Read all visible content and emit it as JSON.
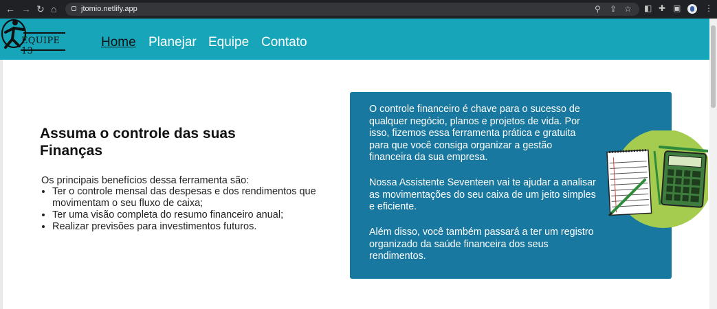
{
  "browser": {
    "url": "jtomio.netlify.app",
    "back_icon": "arrow-left",
    "forward_icon": "arrow-right",
    "reload_icon": "reload",
    "home_icon": "home"
  },
  "header": {
    "logo_text": "EQUIPE 13",
    "nav": [
      "Home",
      "Planejar",
      "Equipe",
      "Contato"
    ],
    "active": "Home",
    "bg_color": "#17a6b9"
  },
  "main": {
    "title": "Assuma o controle das suas Finanças",
    "intro": "Os principais benefícios dessa ferramenta são:",
    "benefits": [
      "Ter o controle mensal das despesas e dos rendimentos que movimentam o seu fluxo de caixa;",
      "Ter uma visão completa do resumo financeiro anual;",
      "Realizar previsões para investimentos futuros."
    ]
  },
  "card": {
    "bg_color": "#19789f",
    "paragraphs": [
      "O controle financeiro é chave para o sucesso de qualquer negócio, planos e projetos de vida. Por isso, fizemos essa ferramenta prática e gratuita para que você consiga organizar a gestão financeira da sua empresa.",
      "Nossa Assistente Seventeen vai te ajudar a analisar as movimentações do seu caixa de um jeito simples e eficiente.",
      "Além disso, você também passará a ter um registro organizado da saúde financeira dos seus rendimentos."
    ],
    "illustration": "notepad-calculator-pencil-illustration"
  }
}
